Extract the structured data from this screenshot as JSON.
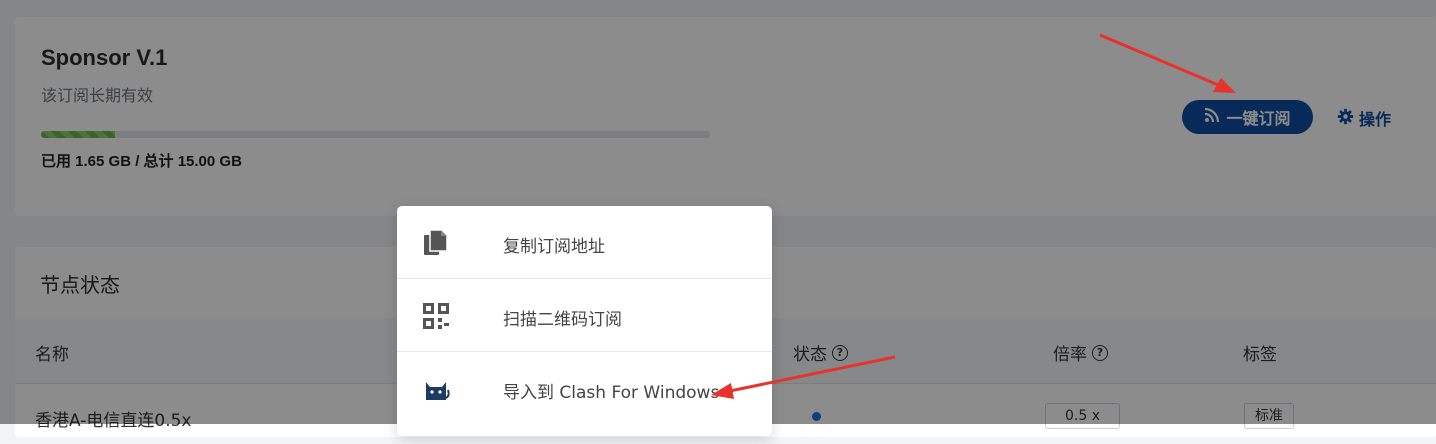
{
  "subscription": {
    "plan_name": "Sponsor V.1",
    "description": "该订阅长期有效",
    "usage_text": "已用 1.65 GB / 总计 15.00 GB",
    "used_fraction": 0.11,
    "subscribe_button": "一键订阅",
    "operations_button": "操作"
  },
  "nodes": {
    "title": "节点状态",
    "columns": {
      "name": "名称",
      "status": "状态",
      "rate": "倍率",
      "tags": "标签"
    },
    "rows": [
      {
        "name": "香港A-电信直连0.5x",
        "rate": "0.5 x",
        "tag": "标准"
      }
    ]
  },
  "dropdown": {
    "items": [
      {
        "label": "复制订阅地址",
        "icon": "copy-icon"
      },
      {
        "label": "扫描二维码订阅",
        "icon": "qrcode-icon"
      },
      {
        "label": "导入到 Clash For Windows",
        "icon": "clash-cat-icon"
      }
    ]
  },
  "colors": {
    "accent": "#0f4ea3",
    "progress": "#6fb553",
    "annotation_arrow": "#e8322c"
  }
}
